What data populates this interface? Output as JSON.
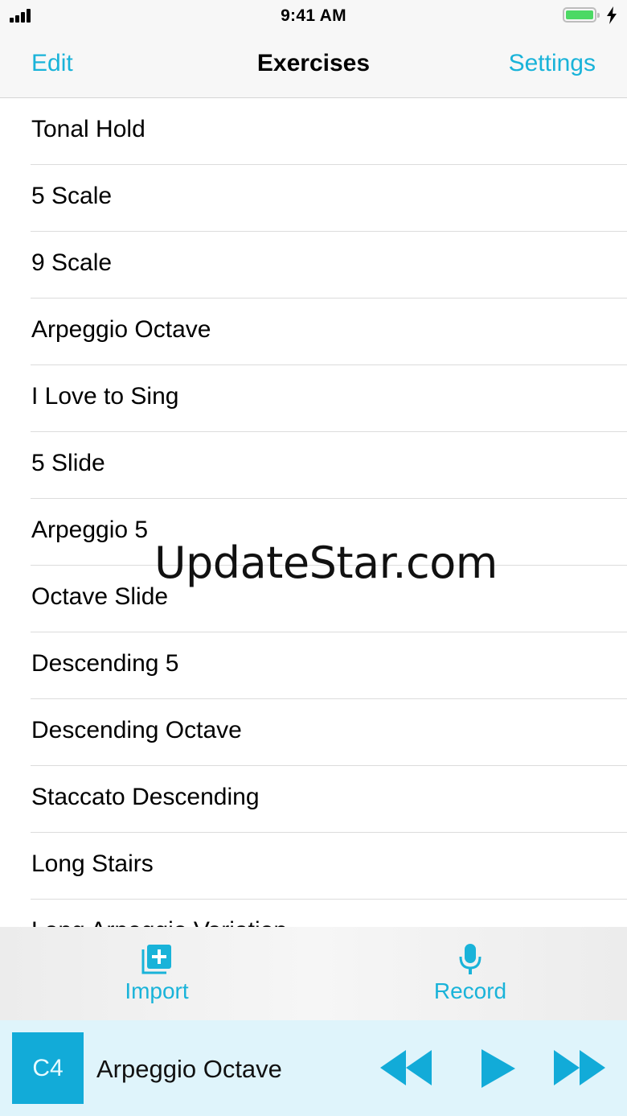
{
  "status_bar": {
    "time": "9:41 AM"
  },
  "nav": {
    "left": "Edit",
    "title": "Exercises",
    "right": "Settings"
  },
  "exercises": [
    "Tonal Hold",
    "5 Scale",
    "9 Scale",
    "Arpeggio Octave",
    "I Love to Sing",
    "5 Slide",
    "Arpeggio 5",
    "Octave Slide",
    "Descending 5",
    "Descending Octave",
    "Staccato Descending",
    "Long Stairs",
    "Long Arpeggio Variation"
  ],
  "watermark": "UpdateStar.com",
  "toolbar": {
    "import_label": "Import",
    "record_label": "Record"
  },
  "player": {
    "key": "C4",
    "title": "Arpeggio Octave"
  },
  "icons": {
    "import": "import-icon",
    "record": "microphone-icon",
    "rewind": "rewind-icon",
    "play": "play-icon",
    "forward": "fast-forward-icon"
  },
  "colors": {
    "accent": "#19b3d9",
    "key_badge": "#12abd8",
    "player_background": "#dff4fb",
    "battery": "#4cd964"
  }
}
